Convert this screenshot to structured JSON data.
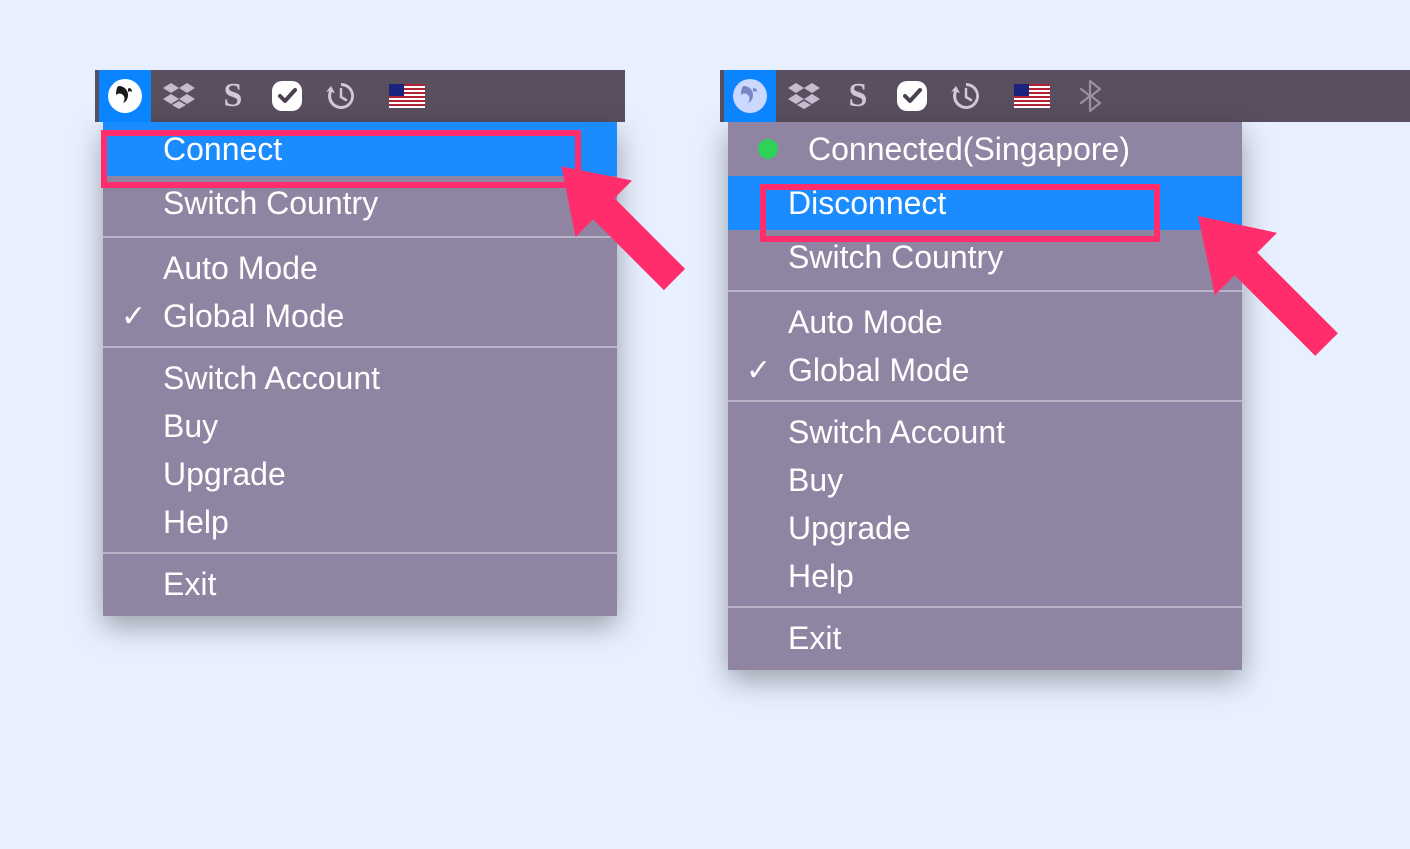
{
  "colors": {
    "highlight": "#1a8cff",
    "annotation": "#ff2d6b",
    "menubar_bg": "#5a4f5f",
    "menu_bg": "#8f85a3",
    "status_dot": "#30d158"
  },
  "menubar_icons": [
    "squirrel-icon",
    "dropbox-icon",
    "s-icon",
    "checkmark-badge-icon",
    "time-machine-icon",
    "us-flag-icon",
    "bluetooth-icon"
  ],
  "left_menu": {
    "highlighted_item": "connect",
    "items": {
      "connect": "Connect",
      "switch_country": "Switch Country",
      "auto_mode": "Auto Mode",
      "global_mode": "Global Mode",
      "switch_account": "Switch Account",
      "buy": "Buy",
      "upgrade": "Upgrade",
      "help": "Help",
      "exit": "Exit"
    },
    "checked": "global_mode"
  },
  "right_menu": {
    "highlighted_item": "disconnect",
    "status_label": "Connected(Singapore)",
    "items": {
      "disconnect": "Disconnect",
      "switch_country": "Switch Country",
      "auto_mode": "Auto Mode",
      "global_mode": "Global Mode",
      "switch_account": "Switch Account",
      "buy": "Buy",
      "upgrade": "Upgrade",
      "help": "Help",
      "exit": "Exit"
    },
    "checked": "global_mode"
  }
}
